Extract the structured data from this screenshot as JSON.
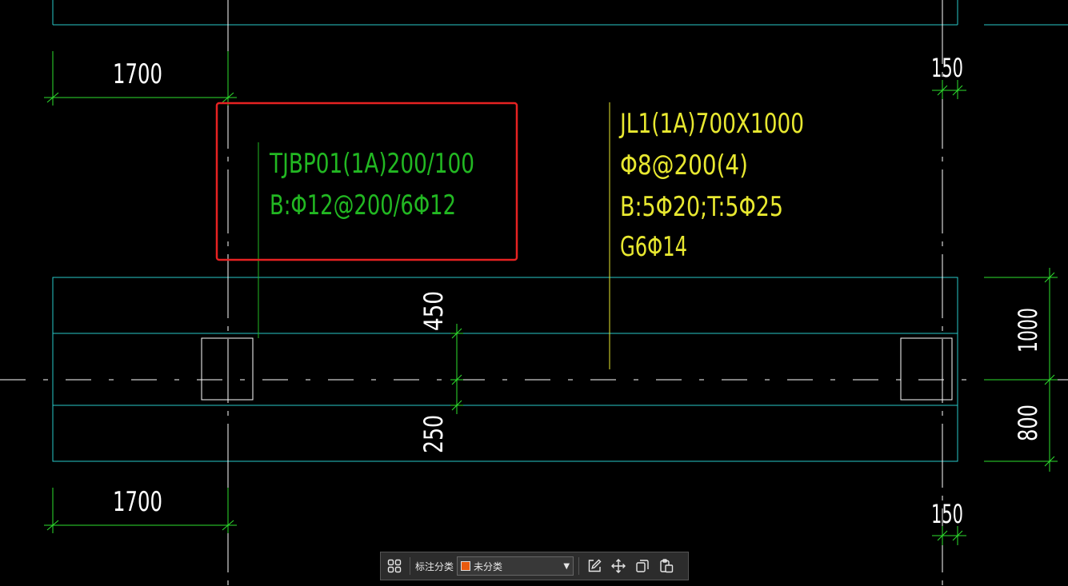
{
  "colors": {
    "background": "#000000",
    "outline": "#28c8c8",
    "dimension": "#2ee02e",
    "label_green": "#22b822",
    "label_yellow": "#e8e830",
    "column": "#ffffff",
    "axis": "#ffffff",
    "highlight": "#e62222",
    "swatch": "#e85a0e"
  },
  "dimensions": {
    "top_left": "1700",
    "bottom_left": "1700",
    "top_right": "150",
    "bottom_right": "150",
    "vertical_upper": "450",
    "vertical_lower": "250",
    "right_upper": "1000",
    "right_lower": "800"
  },
  "labels": {
    "tjbp_line1": "TJBP01(1A)200/100",
    "tjbp_line2": "B:Φ12@200/6Φ12",
    "jl_line1": "JL1(1A)700X1000",
    "jl_line2": "Φ8@200(4)",
    "jl_line3": "B:5Φ20;T:5Φ25",
    "jl_line4": "G6Φ14"
  },
  "toolbar": {
    "grid_icon": "four-squares-icon",
    "category_label": "标注分类",
    "category_value": "未分类",
    "caret": "▼",
    "edit_icon": "edit-icon",
    "move_icon": "move-icon",
    "copy_icon": "copy-icon",
    "paste_icon": "paste-icon"
  }
}
